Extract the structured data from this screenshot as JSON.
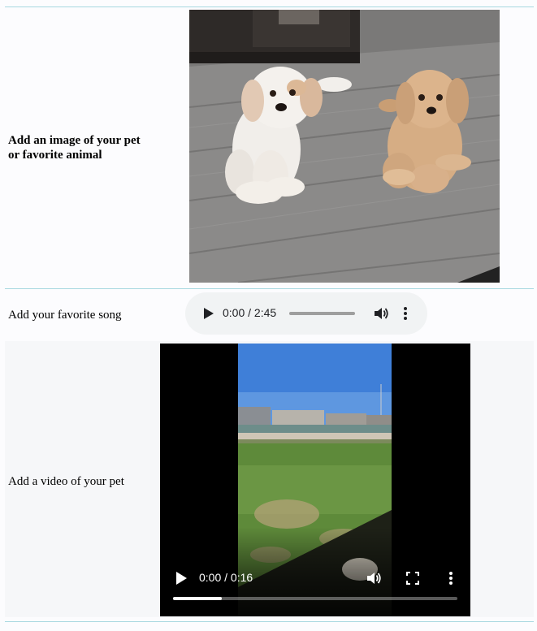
{
  "rows": {
    "pet_image": {
      "label": "Add an image of your pet or favorite animal"
    },
    "song": {
      "label": "Add your favorite song",
      "player": {
        "time": "0:00 / 2:45",
        "progress": 0,
        "icons": [
          "play-icon",
          "volume-icon",
          "more-options-icon"
        ]
      }
    },
    "video": {
      "label": "Add a video of your pet",
      "player": {
        "time": "0:00 / 0:16",
        "progress": 0.17,
        "icons": [
          "play-icon",
          "volume-icon",
          "fullscreen-icon",
          "more-options-icon"
        ]
      }
    }
  },
  "colors": {
    "divider": "#a8d8e0",
    "audio_bg": "#f1f3f4",
    "page_bg": "#fcfcfe"
  }
}
